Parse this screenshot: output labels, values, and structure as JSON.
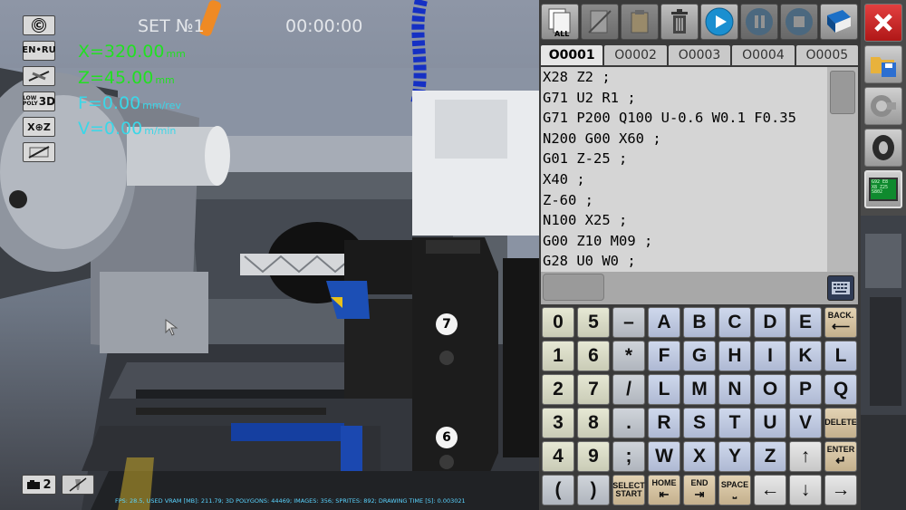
{
  "hud": {
    "copyright_label": "©",
    "lang_label": "EN•RU",
    "quality_label_top": "LOW",
    "quality_label_mid": "POLY",
    "quality_label_3d": "3D",
    "axis_label": "X⊕Z",
    "set_label": "SET №1",
    "timer": "00:00:00",
    "x_value": "X=320.00",
    "x_unit": "mm",
    "z_value": "Z=45.00",
    "z_unit": "mm",
    "f_value": "F=0.00",
    "f_unit": "mm/rev",
    "v_value": "V=0.00",
    "v_unit": "m/min",
    "camera_count": "2",
    "status_line": "FPS: 28.5, USED VRAM [MB]: 211.79; 3D POLYGONS: 44469; IMAGES: 356; SPRITES: 892; DRAWING TIME [S]: 0.003021",
    "turret_pos_top": "7",
    "turret_pos_bottom": "6"
  },
  "toolbar": {
    "all_label": "ALL"
  },
  "tabs": [
    "O0001",
    "O0002",
    "O0003",
    "O0004",
    "O0005"
  ],
  "code_lines": [
    "X28 Z2 ;",
    "G71 U2 R1 ;",
    "G71 P200 Q100 U-0.6 W0.1 F0.35",
    "N200 G00 X60 ;",
    "G01 Z-25 ;",
    "X40 ;",
    "Z-60 ;",
    "N100 X25 ;",
    "G00 Z10 M09 ;",
    "G28 U0 W0 ;"
  ],
  "keypad": [
    [
      "0",
      "5",
      "–",
      "A",
      "B",
      "C",
      "D",
      "E",
      "BACK."
    ],
    [
      "1",
      "6",
      "*",
      "F",
      "G",
      "H",
      "I",
      "K",
      "L"
    ],
    [
      "2",
      "7",
      "/",
      "L",
      "M",
      "N",
      "O",
      "P",
      "Q"
    ],
    [
      "3",
      "8",
      ".",
      "R",
      "S",
      "T",
      "U",
      "V",
      "DELETE"
    ],
    [
      "4",
      "9",
      ";",
      "W",
      "X",
      "Y",
      "Z",
      "↑",
      "ENTER"
    ],
    [
      "(",
      ")",
      "SELECT START",
      "HOME",
      "END",
      "SPACE",
      "←",
      "↓",
      "→"
    ]
  ],
  "side_screen_text": "G92 E8 X8 Z25 S802",
  "colors": {
    "coord_green": "#22e022",
    "coord_cyan": "#3ad7e8",
    "play_blue": "#1a8fd0",
    "close_red": "#d02020"
  }
}
